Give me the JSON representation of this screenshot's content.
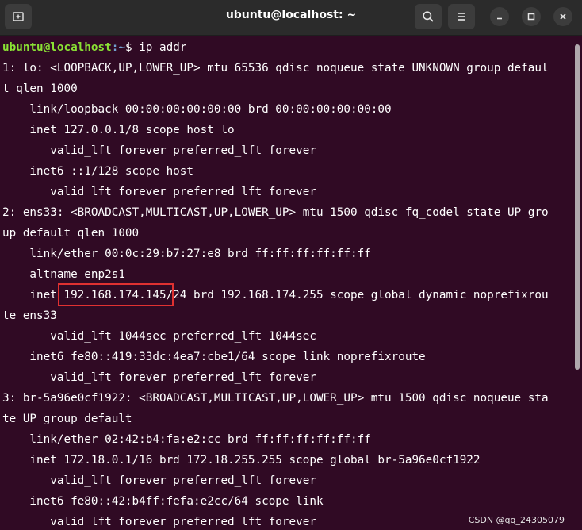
{
  "window": {
    "title": "ubuntu@localhost: ~",
    "icons": [
      "new-tab-icon",
      "search-icon",
      "menu-icon",
      "minimize-icon",
      "maximize-icon",
      "close-icon"
    ]
  },
  "prompt": {
    "user_host": "ubuntu@localhost",
    "path_sep": ":~",
    "symbol": "$ ",
    "command": "ip addr"
  },
  "output": [
    "1: lo: <LOOPBACK,UP,LOWER_UP> mtu 65536 qdisc noqueue state UNKNOWN group defaul",
    "t qlen 1000",
    "    link/loopback 00:00:00:00:00:00 brd 00:00:00:00:00:00",
    "    inet 127.0.0.1/8 scope host lo",
    "       valid_lft forever preferred_lft forever",
    "    inet6 ::1/128 scope host",
    "       valid_lft forever preferred_lft forever",
    "2: ens33: <BROADCAST,MULTICAST,UP,LOWER_UP> mtu 1500 qdisc fq_codel state UP gro",
    "up default qlen 1000",
    "    link/ether 00:0c:29:b7:27:e8 brd ff:ff:ff:ff:ff:ff",
    "    altname enp2s1",
    "    inet 192.168.174.145/24 brd 192.168.174.255 scope global dynamic noprefixrou",
    "te ens33",
    "       valid_lft 1044sec preferred_lft 1044sec",
    "    inet6 fe80::419:33dc:4ea7:cbe1/64 scope link noprefixroute",
    "       valid_lft forever preferred_lft forever",
    "3: br-5a96e0cf1922: <BROADCAST,MULTICAST,UP,LOWER_UP> mtu 1500 qdisc noqueue sta",
    "te UP group default",
    "    link/ether 02:42:b4:fa:e2:cc brd ff:ff:ff:ff:ff:ff",
    "    inet 172.18.0.1/16 brd 172.18.255.255 scope global br-5a96e0cf1922",
    "       valid_lft forever preferred_lft forever",
    "    inet6 fe80::42:b4ff:fefa:e2cc/64 scope link",
    "       valid_lft forever preferred_lft forever"
  ],
  "highlight": {
    "text": "192.168.174.145",
    "color": "#e03131"
  },
  "colors": {
    "background": "#300a24",
    "prompt_user": "#8ae234",
    "prompt_path": "#729fcf",
    "text": "#ffffff"
  },
  "watermark": "CSDN @qq_24305079"
}
